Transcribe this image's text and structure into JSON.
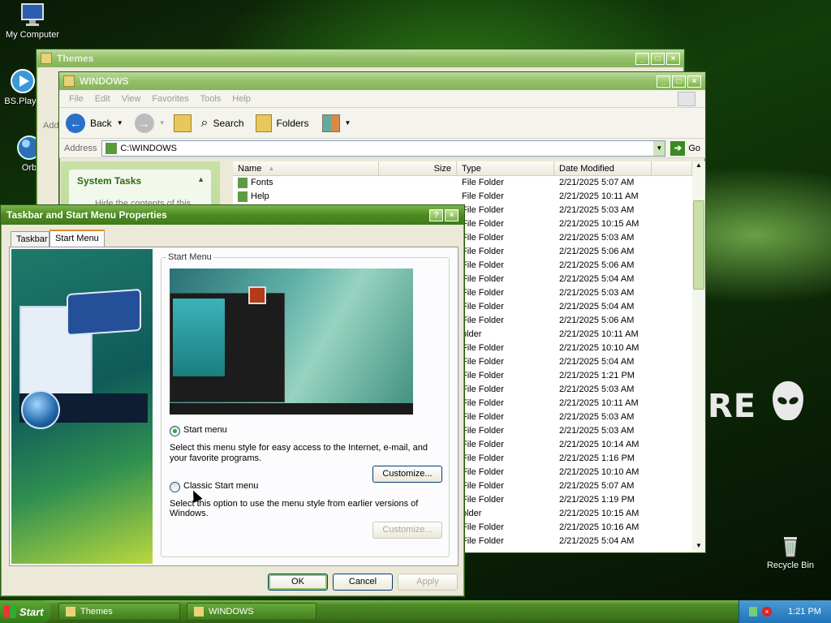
{
  "desktop": {
    "icons": [
      {
        "label": "My Computer"
      },
      {
        "label": "BS.Playe"
      },
      {
        "label": "Orb"
      },
      {
        "label": "Recycle Bin"
      }
    ],
    "brand_text": "RE"
  },
  "themes_window": {
    "title": "Themes",
    "partial_text": "Add"
  },
  "explorer": {
    "title": "WINDOWS",
    "menu": [
      "File",
      "Edit",
      "View",
      "Favorites",
      "Tools",
      "Help"
    ],
    "toolbar": {
      "back": "Back",
      "search": "Search",
      "folders": "Folders"
    },
    "address_label": "Address",
    "address_value": "C:\\WINDOWS",
    "go_label": "Go",
    "tasks_header": "System Tasks",
    "tasks_partial": "Hide the contents of this",
    "columns": [
      "Name",
      "Size",
      "Type",
      "Date Modified"
    ],
    "rows": [
      {
        "name": "Fonts",
        "type": "File Folder",
        "date": "2/21/2025 5:07 AM"
      },
      {
        "name": "Help",
        "type": "File Folder",
        "date": "2/21/2025 10:11 AM"
      },
      {
        "name": "",
        "type": "File Folder",
        "date": "2/21/2025 5:03 AM"
      },
      {
        "name": "",
        "type": "File Folder",
        "date": "2/21/2025 10:15 AM"
      },
      {
        "name": "",
        "type": "File Folder",
        "date": "2/21/2025 5:03 AM"
      },
      {
        "name": "",
        "type": "File Folder",
        "date": "2/21/2025 5:06 AM"
      },
      {
        "name": "",
        "type": "File Folder",
        "date": "2/21/2025 5:06 AM"
      },
      {
        "name": "",
        "type": "File Folder",
        "date": "2/21/2025 5:04 AM"
      },
      {
        "name": "",
        "type": "File Folder",
        "date": "2/21/2025 5:03 AM"
      },
      {
        "name": "",
        "type": "File Folder",
        "date": "2/21/2025 5:04 AM"
      },
      {
        "name": "",
        "type": "File Folder",
        "date": "2/21/2025 5:06 AM"
      },
      {
        "name": "",
        "type": "older",
        "date": "2/21/2025 10:11 AM"
      },
      {
        "name": "",
        "type": "File Folder",
        "date": "2/21/2025 10:10 AM"
      },
      {
        "name": "",
        "type": "File Folder",
        "date": "2/21/2025 5:04 AM"
      },
      {
        "name": "",
        "type": "File Folder",
        "date": "2/21/2025 1:21 PM"
      },
      {
        "name": "",
        "type": "File Folder",
        "date": "2/21/2025 5:03 AM"
      },
      {
        "name": "",
        "type": "File Folder",
        "date": "2/21/2025 10:11 AM"
      },
      {
        "name": "",
        "type": "File Folder",
        "date": "2/21/2025 5:03 AM"
      },
      {
        "name": "",
        "type": "File Folder",
        "date": "2/21/2025 5:03 AM"
      },
      {
        "name": "",
        "type": "File Folder",
        "date": "2/21/2025 10:14 AM"
      },
      {
        "name": "",
        "type": "File Folder",
        "date": "2/21/2025 1:16 PM"
      },
      {
        "name": "",
        "type": "File Folder",
        "date": "2/21/2025 10:10 AM"
      },
      {
        "name": "",
        "type": "File Folder",
        "date": "2/21/2025 5:07 AM"
      },
      {
        "name": "",
        "type": "File Folder",
        "date": "2/21/2025 1:19 PM"
      },
      {
        "name": "",
        "type": "older",
        "date": "2/21/2025 10:15 AM"
      },
      {
        "name": "",
        "type": "File Folder",
        "date": "2/21/2025 10:16 AM"
      },
      {
        "name": "",
        "type": "File Folder",
        "date": "2/21/2025 5:04 AM"
      }
    ]
  },
  "dialog": {
    "title": "Taskbar and Start Menu Properties",
    "tabs": [
      "Taskbar",
      "Start Menu"
    ],
    "group_label": "Start Menu",
    "option1_label": "Start menu",
    "option1_desc": "Select this menu style for easy access to the Internet, e-mail, and your favorite programs.",
    "option2_label": "Classic Start menu",
    "option2_desc": "Select this option to use the menu style from earlier versions of Windows.",
    "customize_label": "Customize...",
    "customize2_label": "Customize...",
    "ok": "OK",
    "cancel": "Cancel",
    "apply": "Apply"
  },
  "taskbar": {
    "start": "Start",
    "items": [
      "Themes",
      "WINDOWS"
    ],
    "clock": "1:21 PM"
  }
}
